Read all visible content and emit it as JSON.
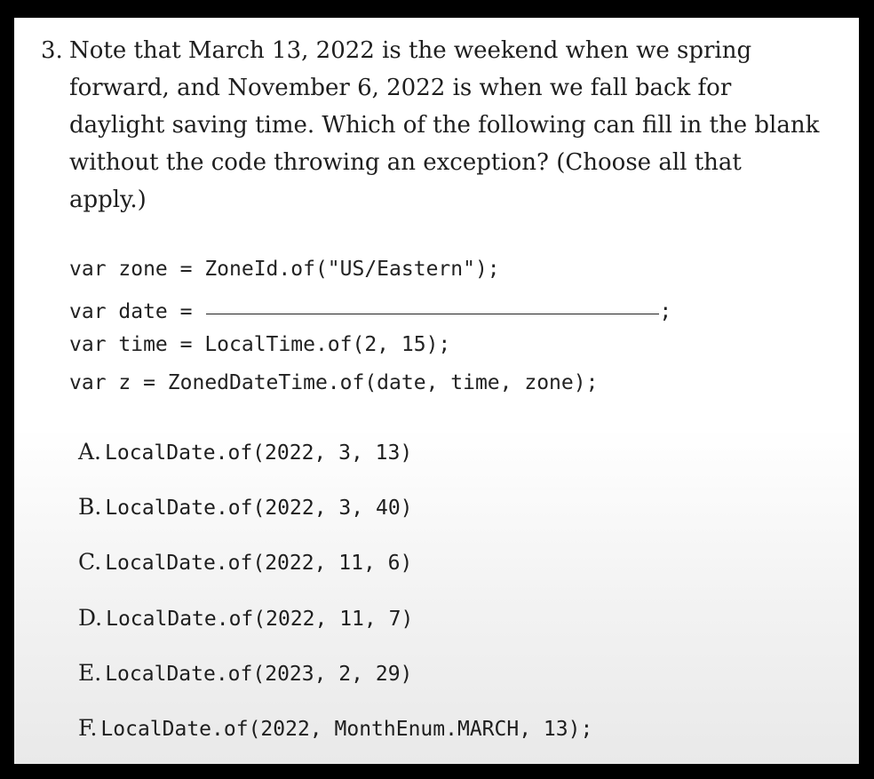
{
  "question": {
    "number": "3.",
    "text": "Note that March 13, 2022 is the weekend when we spring forward, and November 6, 2022 is when we fall back for daylight saving time. Which of the following can fill in the blank without the code throwing an exception? (Choose all that apply.)"
  },
  "code": {
    "line1": "var zone = ZoneId.of(\"US/Eastern\");",
    "line2_prefix": "var date = ",
    "line2_suffix": ";",
    "line3": "var time = LocalTime.of(2, 15);",
    "line4": "var z = ZonedDateTime.of(date, time, zone);"
  },
  "options": [
    {
      "letter": "A.",
      "code": "LocalDate.of(2022, 3, 13)"
    },
    {
      "letter": "B.",
      "code": "LocalDate.of(2022, 3, 40)"
    },
    {
      "letter": "C.",
      "code": "LocalDate.of(2022, 11, 6)"
    },
    {
      "letter": "D.",
      "code": "LocalDate.of(2022, 11, 7)"
    },
    {
      "letter": "E.",
      "code": "LocalDate.of(2023, 2, 29)"
    },
    {
      "letter": "F.",
      "code": "LocalDate.of(2022, MonthEnum.MARCH, 13);"
    }
  ]
}
